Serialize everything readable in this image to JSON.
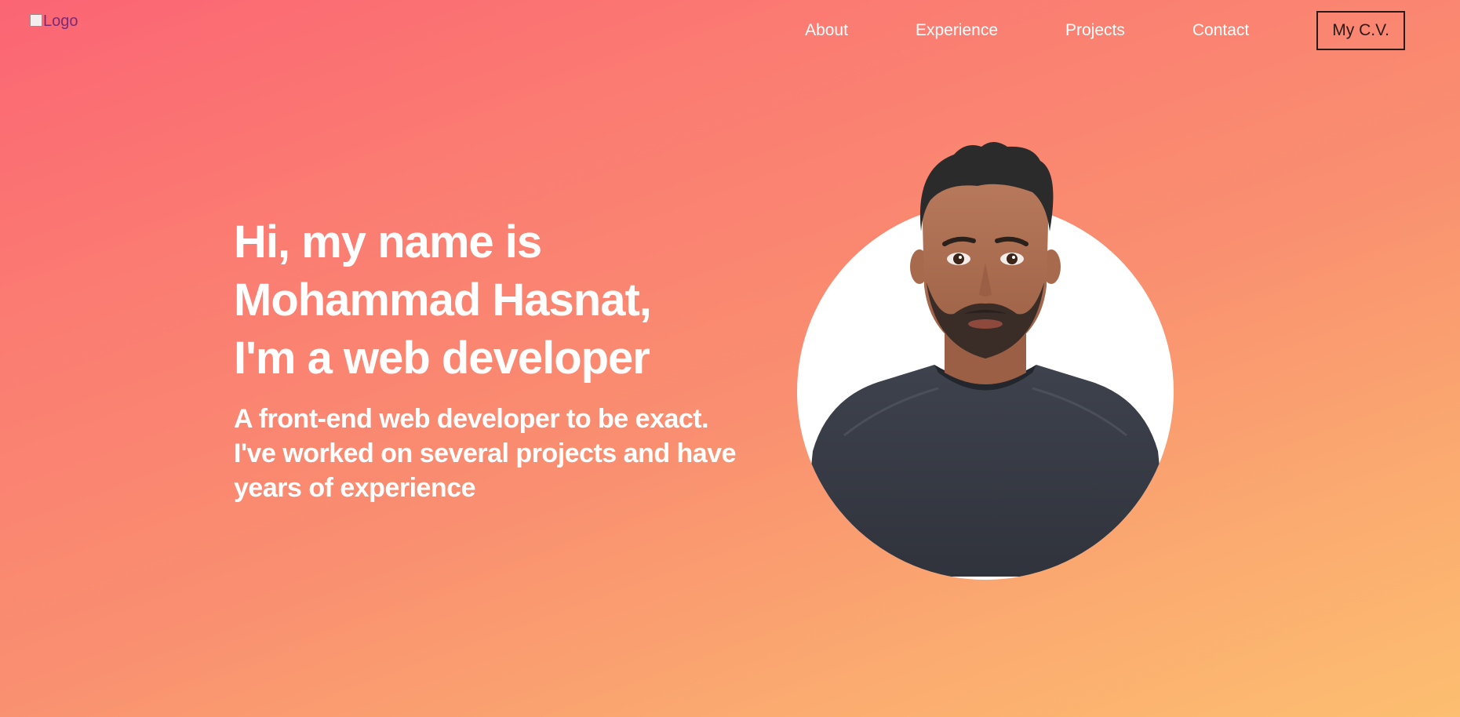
{
  "header": {
    "logo_alt": "Logo",
    "nav": [
      {
        "label": "About"
      },
      {
        "label": "Experience"
      },
      {
        "label": "Projects"
      },
      {
        "label": "Contact"
      }
    ],
    "cv_label": "My C.V."
  },
  "hero": {
    "title_lines": [
      "Hi, my name is",
      "Mohammad Hasnat,",
      "I'm a web developer"
    ],
    "subtitle_lines": [
      "A front-end web developer to be exact.",
      "I've worked on several projects and have",
      "years of experience"
    ]
  },
  "colors": {
    "gradient_start": "#fb6574",
    "gradient_end": "#fcbe70",
    "text": "#ffffff",
    "cv_border": "#2a1a1a"
  },
  "icons": {
    "logo": "broken-image-icon",
    "avatar": "user-avatar"
  }
}
